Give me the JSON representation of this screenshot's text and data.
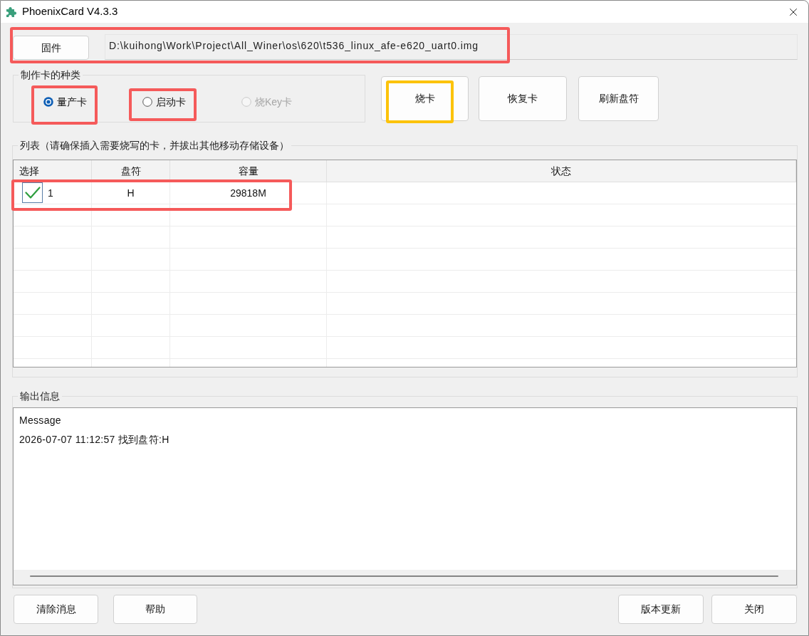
{
  "window": {
    "title": "PhoenixCard V4.3.3"
  },
  "firmware": {
    "button": "固件",
    "path": "D:\\kuihong\\Work\\Project\\All_Winer\\os\\620\\t536_linux_afe-e620_uart0.img"
  },
  "card_type": {
    "legend": "制作卡的种类",
    "options": [
      {
        "label": "量产卡",
        "selected": true,
        "disabled": false
      },
      {
        "label": "启动卡",
        "selected": false,
        "disabled": false
      },
      {
        "label": "烧Key卡",
        "selected": false,
        "disabled": true
      }
    ]
  },
  "actions": [
    "烧卡",
    "恢复卡",
    "刷新盘符"
  ],
  "list": {
    "legend": "列表（请确保插入需要烧写的卡，并拔出其他移动存储设备）",
    "columns": [
      "选择",
      "盘符",
      "容量",
      "状态"
    ],
    "rows": [
      {
        "checked": true,
        "index": "1",
        "drive": "H",
        "capacity": "29818M"
      }
    ]
  },
  "output": {
    "legend": "输出信息",
    "lines": [
      "Message",
      "2026-07-07 11:12:57 找到盘符:H"
    ]
  },
  "buttons": [
    "清除消息",
    "帮助",
    "版本更新",
    "关闭"
  ],
  "annotations": [
    {
      "color": "#f55a5a"
    },
    {
      "color": "#f55a5a"
    },
    {
      "color": "#f55a5a"
    },
    {
      "color": "#f55a5a"
    },
    {
      "color": "#fcc30b"
    }
  ]
}
